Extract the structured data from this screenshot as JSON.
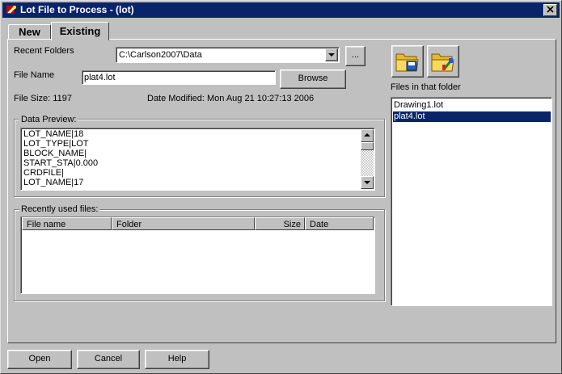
{
  "window": {
    "title": "Lot File to Process - (lot)"
  },
  "tabs": [
    {
      "label": "New"
    },
    {
      "label": "Existing"
    }
  ],
  "recent_folders": {
    "label": "Recent Folders",
    "value": "C:\\Carlson2007\\Data",
    "browse_label": "..."
  },
  "file_name": {
    "label": "File Name",
    "value": "plat4.lot",
    "browse_label": "Browse"
  },
  "file_info": {
    "size": "File Size: 1197",
    "modified": "Date Modified: Mon Aug 21 10:27:13 2006"
  },
  "data_preview": {
    "title": "Data Preview:",
    "lines": [
      "LOT_NAME|18",
      "LOT_TYPE|LOT",
      "BLOCK_NAME|",
      "START_STA|0.000",
      "CRDFILE|",
      "LOT_NAME|17"
    ]
  },
  "recent_files": {
    "title": "Recently used files:",
    "columns": [
      "File name",
      "Folder",
      "Size",
      "Date"
    ]
  },
  "folder_files": {
    "label": "Files in that folder",
    "items": [
      "Drawing1.lot",
      "plat4.lot"
    ],
    "selected_index": 1
  },
  "buttons": {
    "open": "Open",
    "cancel": "Cancel",
    "help": "Help"
  },
  "colors": {
    "titlebar": "#0a246a",
    "face": "#c0c0c0",
    "selection": "#0a246a"
  }
}
